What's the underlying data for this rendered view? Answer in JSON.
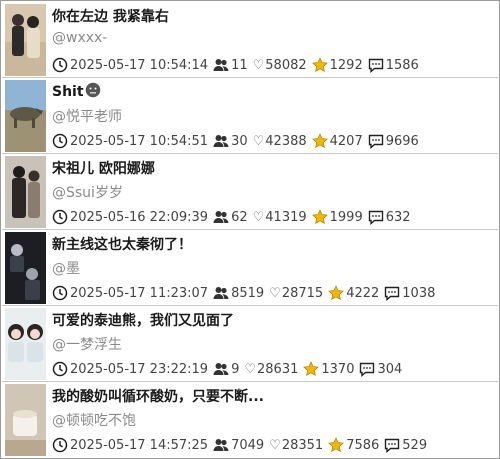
{
  "posts": [
    {
      "title": "你在左边 我紧靠右",
      "author": "@wxxx-",
      "time": "2025-05-17 10:54:14",
      "followers": "11",
      "likes": "58082",
      "favorites": "1292",
      "comments": "1586",
      "thumb": {
        "bg": "#d8c8b0",
        "a": "#2d2a2a",
        "b": "#e8dcc8"
      }
    },
    {
      "title": "Shit",
      "title_emoji": "neutral-face-icon",
      "author": "@悦平老师",
      "time": "2025-05-17 10:54:51",
      "followers": "30",
      "likes": "42388",
      "favorites": "4207",
      "comments": "9696",
      "thumb": {
        "bg": "#8fb4d6",
        "a": "#6f6a52",
        "b": "#4e4a3a"
      }
    },
    {
      "title": "宋祖儿 欧阳娜娜",
      "author": "@Ssui岁岁",
      "time": "2025-05-16 22:09:39",
      "followers": "62",
      "likes": "41319",
      "favorites": "1999",
      "comments": "632",
      "thumb": {
        "bg": "#c9c2b8",
        "a": "#1f1d1c",
        "b": "#8a7d70"
      }
    },
    {
      "title": "新主线这也太秦彻了！",
      "author": "@墨",
      "time": "2025-05-17 11:23:07",
      "followers": "8519",
      "likes": "28715",
      "favorites": "4222",
      "comments": "1038",
      "thumb": {
        "bg": "#1c1e24",
        "a": "#3a3f4a",
        "b": "#b9bcc4"
      }
    },
    {
      "title": "可爱的泰迪熊，我们又见面了",
      "author": "@一梦浮生",
      "time": "2025-05-17 23:22:19",
      "followers": "9",
      "likes": "28631",
      "favorites": "1370",
      "comments": "304",
      "thumb": {
        "bg": "#e9eef0",
        "a": "#2b2420",
        "b": "#f3d9cf"
      }
    },
    {
      "title": "我的酸奶叫循环酸奶，只要不断...",
      "author": "@顿顿吃不饱",
      "time": "2025-05-17 14:57:25",
      "followers": "7049",
      "likes": "28351",
      "favorites": "7586",
      "comments": "529",
      "thumb": {
        "bg": "#cfc6b6",
        "a": "#f4f1ea",
        "b": "#b8a88f"
      }
    }
  ],
  "icons": {
    "time": "clock-icon",
    "followers": "users-icon",
    "likes": "heart-icon",
    "favorites": "star-icon",
    "comments": "comment-icon"
  },
  "colors": {
    "star": "#f2b705",
    "divider": "#c9c9c9",
    "author": "#8a8a8a"
  }
}
